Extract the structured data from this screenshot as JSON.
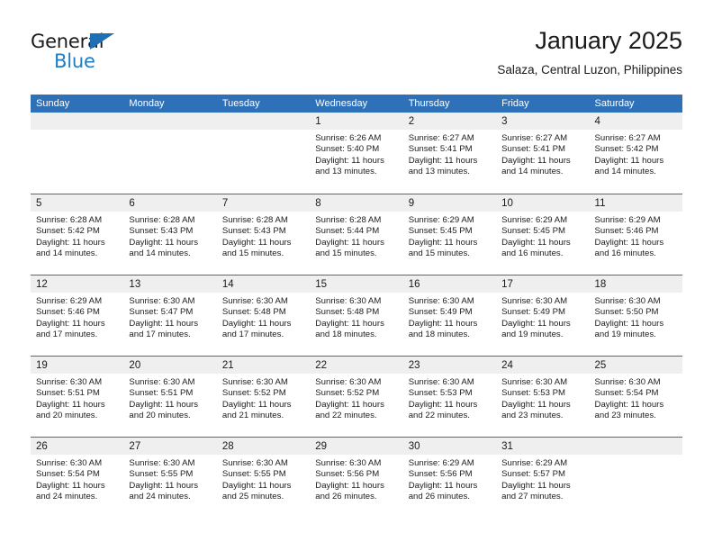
{
  "brand": {
    "name_part1": "General",
    "name_part2": "Blue",
    "accent_color": "#1f7ec4",
    "triangle_color": "#1f6fb5"
  },
  "header": {
    "title": "January 2025",
    "subtitle": "Salaza, Central Luzon, Philippines"
  },
  "theme": {
    "header_blue": "#2e71b8",
    "day_band_gray": "#efefef",
    "text_color": "#1a1a1a"
  },
  "weekdays": [
    "Sunday",
    "Monday",
    "Tuesday",
    "Wednesday",
    "Thursday",
    "Friday",
    "Saturday"
  ],
  "weeks": [
    [
      {
        "day": "",
        "sunrise": "",
        "sunset": "",
        "daylight_line1": "",
        "daylight_line2": ""
      },
      {
        "day": "",
        "sunrise": "",
        "sunset": "",
        "daylight_line1": "",
        "daylight_line2": ""
      },
      {
        "day": "",
        "sunrise": "",
        "sunset": "",
        "daylight_line1": "",
        "daylight_line2": ""
      },
      {
        "day": "1",
        "sunrise": "Sunrise: 6:26 AM",
        "sunset": "Sunset: 5:40 PM",
        "daylight_line1": "Daylight: 11 hours",
        "daylight_line2": "and 13 minutes."
      },
      {
        "day": "2",
        "sunrise": "Sunrise: 6:27 AM",
        "sunset": "Sunset: 5:41 PM",
        "daylight_line1": "Daylight: 11 hours",
        "daylight_line2": "and 13 minutes."
      },
      {
        "day": "3",
        "sunrise": "Sunrise: 6:27 AM",
        "sunset": "Sunset: 5:41 PM",
        "daylight_line1": "Daylight: 11 hours",
        "daylight_line2": "and 14 minutes."
      },
      {
        "day": "4",
        "sunrise": "Sunrise: 6:27 AM",
        "sunset": "Sunset: 5:42 PM",
        "daylight_line1": "Daylight: 11 hours",
        "daylight_line2": "and 14 minutes."
      }
    ],
    [
      {
        "day": "5",
        "sunrise": "Sunrise: 6:28 AM",
        "sunset": "Sunset: 5:42 PM",
        "daylight_line1": "Daylight: 11 hours",
        "daylight_line2": "and 14 minutes."
      },
      {
        "day": "6",
        "sunrise": "Sunrise: 6:28 AM",
        "sunset": "Sunset: 5:43 PM",
        "daylight_line1": "Daylight: 11 hours",
        "daylight_line2": "and 14 minutes."
      },
      {
        "day": "7",
        "sunrise": "Sunrise: 6:28 AM",
        "sunset": "Sunset: 5:43 PM",
        "daylight_line1": "Daylight: 11 hours",
        "daylight_line2": "and 15 minutes."
      },
      {
        "day": "8",
        "sunrise": "Sunrise: 6:28 AM",
        "sunset": "Sunset: 5:44 PM",
        "daylight_line1": "Daylight: 11 hours",
        "daylight_line2": "and 15 minutes."
      },
      {
        "day": "9",
        "sunrise": "Sunrise: 6:29 AM",
        "sunset": "Sunset: 5:45 PM",
        "daylight_line1": "Daylight: 11 hours",
        "daylight_line2": "and 15 minutes."
      },
      {
        "day": "10",
        "sunrise": "Sunrise: 6:29 AM",
        "sunset": "Sunset: 5:45 PM",
        "daylight_line1": "Daylight: 11 hours",
        "daylight_line2": "and 16 minutes."
      },
      {
        "day": "11",
        "sunrise": "Sunrise: 6:29 AM",
        "sunset": "Sunset: 5:46 PM",
        "daylight_line1": "Daylight: 11 hours",
        "daylight_line2": "and 16 minutes."
      }
    ],
    [
      {
        "day": "12",
        "sunrise": "Sunrise: 6:29 AM",
        "sunset": "Sunset: 5:46 PM",
        "daylight_line1": "Daylight: 11 hours",
        "daylight_line2": "and 17 minutes."
      },
      {
        "day": "13",
        "sunrise": "Sunrise: 6:30 AM",
        "sunset": "Sunset: 5:47 PM",
        "daylight_line1": "Daylight: 11 hours",
        "daylight_line2": "and 17 minutes."
      },
      {
        "day": "14",
        "sunrise": "Sunrise: 6:30 AM",
        "sunset": "Sunset: 5:48 PM",
        "daylight_line1": "Daylight: 11 hours",
        "daylight_line2": "and 17 minutes."
      },
      {
        "day": "15",
        "sunrise": "Sunrise: 6:30 AM",
        "sunset": "Sunset: 5:48 PM",
        "daylight_line1": "Daylight: 11 hours",
        "daylight_line2": "and 18 minutes."
      },
      {
        "day": "16",
        "sunrise": "Sunrise: 6:30 AM",
        "sunset": "Sunset: 5:49 PM",
        "daylight_line1": "Daylight: 11 hours",
        "daylight_line2": "and 18 minutes."
      },
      {
        "day": "17",
        "sunrise": "Sunrise: 6:30 AM",
        "sunset": "Sunset: 5:49 PM",
        "daylight_line1": "Daylight: 11 hours",
        "daylight_line2": "and 19 minutes."
      },
      {
        "day": "18",
        "sunrise": "Sunrise: 6:30 AM",
        "sunset": "Sunset: 5:50 PM",
        "daylight_line1": "Daylight: 11 hours",
        "daylight_line2": "and 19 minutes."
      }
    ],
    [
      {
        "day": "19",
        "sunrise": "Sunrise: 6:30 AM",
        "sunset": "Sunset: 5:51 PM",
        "daylight_line1": "Daylight: 11 hours",
        "daylight_line2": "and 20 minutes."
      },
      {
        "day": "20",
        "sunrise": "Sunrise: 6:30 AM",
        "sunset": "Sunset: 5:51 PM",
        "daylight_line1": "Daylight: 11 hours",
        "daylight_line2": "and 20 minutes."
      },
      {
        "day": "21",
        "sunrise": "Sunrise: 6:30 AM",
        "sunset": "Sunset: 5:52 PM",
        "daylight_line1": "Daylight: 11 hours",
        "daylight_line2": "and 21 minutes."
      },
      {
        "day": "22",
        "sunrise": "Sunrise: 6:30 AM",
        "sunset": "Sunset: 5:52 PM",
        "daylight_line1": "Daylight: 11 hours",
        "daylight_line2": "and 22 minutes."
      },
      {
        "day": "23",
        "sunrise": "Sunrise: 6:30 AM",
        "sunset": "Sunset: 5:53 PM",
        "daylight_line1": "Daylight: 11 hours",
        "daylight_line2": "and 22 minutes."
      },
      {
        "day": "24",
        "sunrise": "Sunrise: 6:30 AM",
        "sunset": "Sunset: 5:53 PM",
        "daylight_line1": "Daylight: 11 hours",
        "daylight_line2": "and 23 minutes."
      },
      {
        "day": "25",
        "sunrise": "Sunrise: 6:30 AM",
        "sunset": "Sunset: 5:54 PM",
        "daylight_line1": "Daylight: 11 hours",
        "daylight_line2": "and 23 minutes."
      }
    ],
    [
      {
        "day": "26",
        "sunrise": "Sunrise: 6:30 AM",
        "sunset": "Sunset: 5:54 PM",
        "daylight_line1": "Daylight: 11 hours",
        "daylight_line2": "and 24 minutes."
      },
      {
        "day": "27",
        "sunrise": "Sunrise: 6:30 AM",
        "sunset": "Sunset: 5:55 PM",
        "daylight_line1": "Daylight: 11 hours",
        "daylight_line2": "and 24 minutes."
      },
      {
        "day": "28",
        "sunrise": "Sunrise: 6:30 AM",
        "sunset": "Sunset: 5:55 PM",
        "daylight_line1": "Daylight: 11 hours",
        "daylight_line2": "and 25 minutes."
      },
      {
        "day": "29",
        "sunrise": "Sunrise: 6:30 AM",
        "sunset": "Sunset: 5:56 PM",
        "daylight_line1": "Daylight: 11 hours",
        "daylight_line2": "and 26 minutes."
      },
      {
        "day": "30",
        "sunrise": "Sunrise: 6:29 AM",
        "sunset": "Sunset: 5:56 PM",
        "daylight_line1": "Daylight: 11 hours",
        "daylight_line2": "and 26 minutes."
      },
      {
        "day": "31",
        "sunrise": "Sunrise: 6:29 AM",
        "sunset": "Sunset: 5:57 PM",
        "daylight_line1": "Daylight: 11 hours",
        "daylight_line2": "and 27 minutes."
      },
      {
        "day": "",
        "sunrise": "",
        "sunset": "",
        "daylight_line1": "",
        "daylight_line2": ""
      }
    ]
  ]
}
